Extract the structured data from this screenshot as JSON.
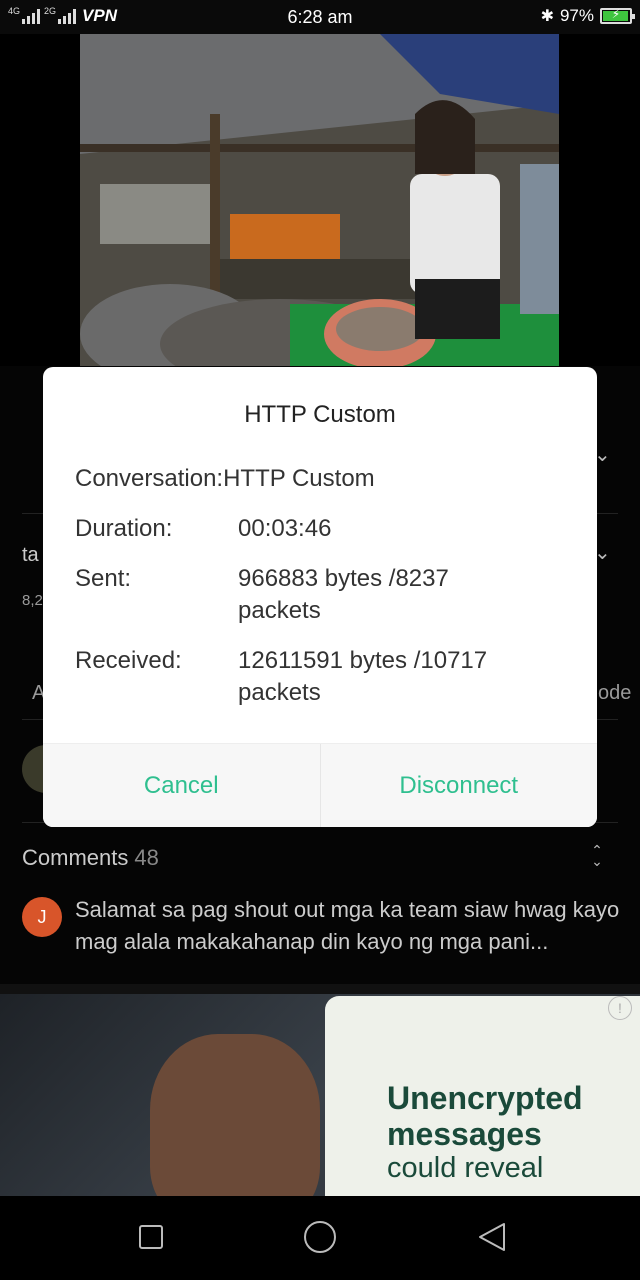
{
  "status_bar": {
    "net_type_1": "4G",
    "net_type_2": "2G",
    "vpn": "VPN",
    "time": "6:28 am",
    "battery_percent": "97%",
    "battery_level": 0.97,
    "icons": [
      "signal-icon",
      "bluetooth-icon",
      "battery-charging-icon"
    ]
  },
  "background": {
    "title_fragment": "ta",
    "views_fragment": "8,2",
    "tab_fragment_left": "A",
    "tab_fragment_right": "ode"
  },
  "dialog": {
    "title": "HTTP Custom",
    "rows": [
      {
        "label": "Conversation:",
        "value": "HTTP Custom"
      },
      {
        "label": "Duration:",
        "value": "00:03:46"
      },
      {
        "label": "Sent:",
        "value": "966883 bytes /8237 packets"
      },
      {
        "label": "Received:",
        "value": "12611591 bytes /10717 packets"
      }
    ],
    "cancel_label": "Cancel",
    "disconnect_label": "Disconnect",
    "accent_color": "#2fbf8f"
  },
  "comments": {
    "label": "Comments",
    "count": "48",
    "first": {
      "avatar_letter": "J",
      "text": "Salamat sa pag shout out mga ka team siaw hwag kayo mag alala makakahanap din kayo ng mga pani..."
    }
  },
  "ad": {
    "headline": "Unencrypted messages",
    "subline": "could reveal",
    "info_icon": "info-icon"
  },
  "navbar": {
    "icons": [
      "recents-square-icon",
      "home-circle-icon",
      "back-triangle-icon"
    ]
  }
}
